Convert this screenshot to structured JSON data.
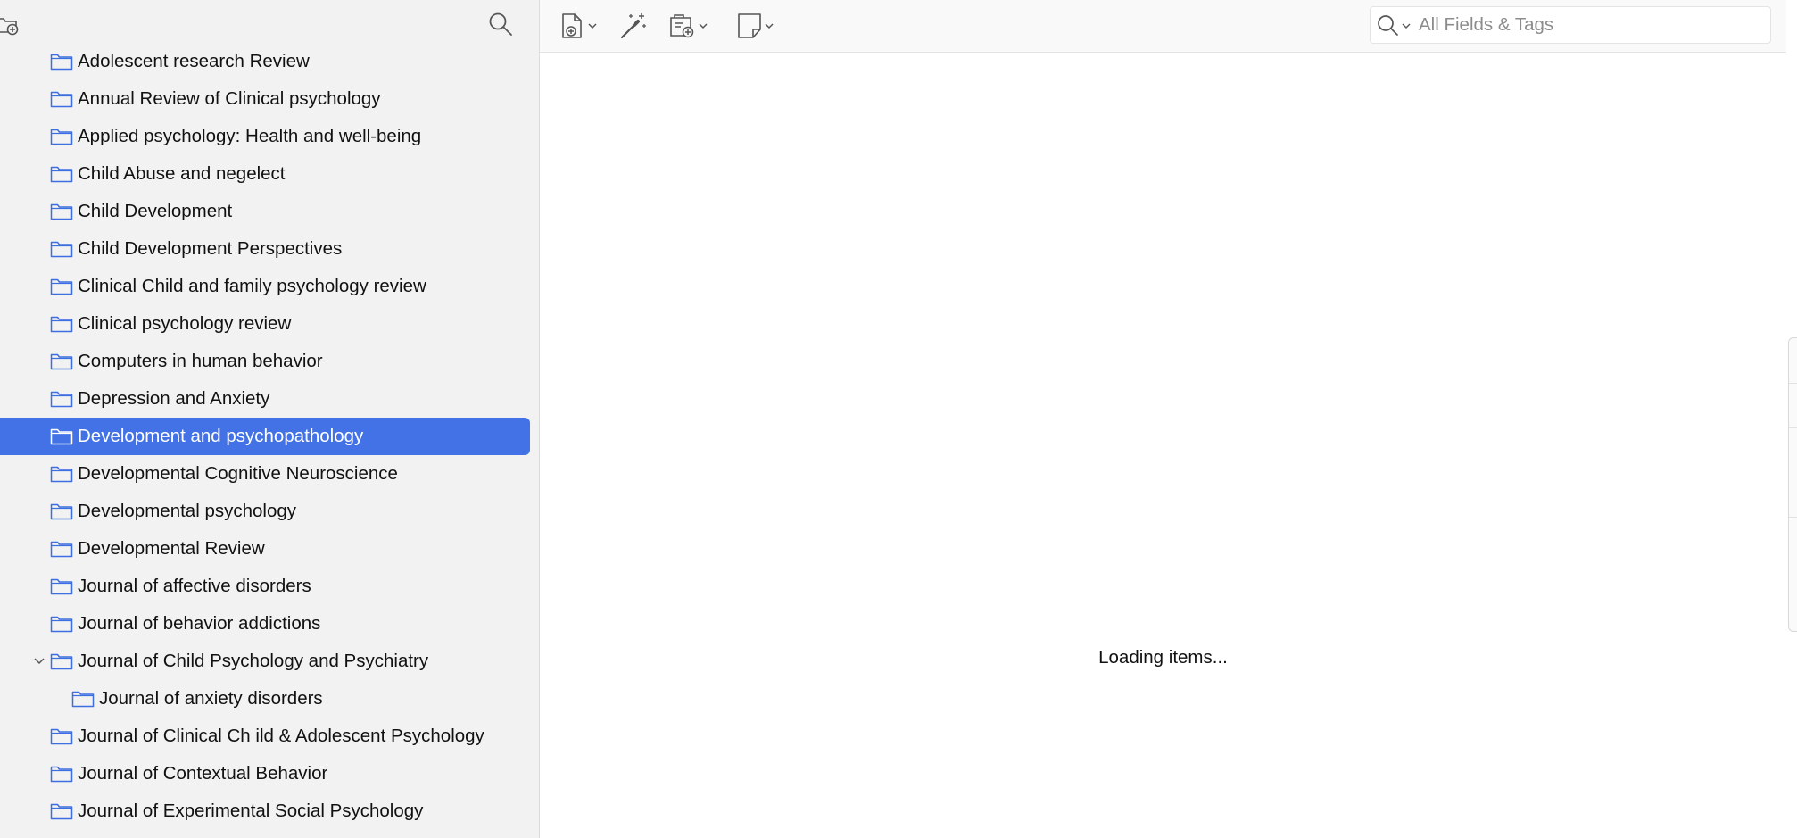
{
  "sidebar": {
    "collections": [
      {
        "label": "Adolescent research Review",
        "level": 0,
        "selected": false,
        "expandable": false
      },
      {
        "label": "Annual Review of Clinical psychology",
        "level": 0,
        "selected": false,
        "expandable": false
      },
      {
        "label": "Applied psychology: Health and well-being",
        "level": 0,
        "selected": false,
        "expandable": false
      },
      {
        "label": "Child Abuse and negelect",
        "level": 0,
        "selected": false,
        "expandable": false
      },
      {
        "label": "Child Development",
        "level": 0,
        "selected": false,
        "expandable": false
      },
      {
        "label": "Child Development Perspectives",
        "level": 0,
        "selected": false,
        "expandable": false
      },
      {
        "label": "Clinical Child and family psychology review",
        "level": 0,
        "selected": false,
        "expandable": false
      },
      {
        "label": "Clinical psychology review",
        "level": 0,
        "selected": false,
        "expandable": false
      },
      {
        "label": "Computers in human behavior",
        "level": 0,
        "selected": false,
        "expandable": false
      },
      {
        "label": "Depression and Anxiety",
        "level": 0,
        "selected": false,
        "expandable": false
      },
      {
        "label": "Development and psychopathology",
        "level": 0,
        "selected": true,
        "expandable": false
      },
      {
        "label": "Developmental Cognitive Neuroscience",
        "level": 0,
        "selected": false,
        "expandable": false
      },
      {
        "label": "Developmental psychology",
        "level": 0,
        "selected": false,
        "expandable": false
      },
      {
        "label": "Developmental Review",
        "level": 0,
        "selected": false,
        "expandable": false
      },
      {
        "label": "Journal of affective disorders",
        "level": 0,
        "selected": false,
        "expandable": false
      },
      {
        "label": "Journal of behavior addictions",
        "level": 0,
        "selected": false,
        "expandable": false
      },
      {
        "label": "Journal of Child Psychology and Psychiatry",
        "level": 0,
        "selected": false,
        "expandable": true,
        "expanded": true
      },
      {
        "label": "Journal of anxiety disorders",
        "level": 1,
        "selected": false,
        "expandable": false
      },
      {
        "label": "Journal of Clinical Ch ild & Adolescent Psychology",
        "level": 0,
        "selected": false,
        "expandable": false
      },
      {
        "label": "Journal of Contextual Behavior",
        "level": 0,
        "selected": false,
        "expandable": false
      },
      {
        "label": "Journal of Experimental Social Psychology",
        "level": 0,
        "selected": false,
        "expandable": false
      }
    ]
  },
  "main": {
    "search": {
      "placeholder": "All Fields & Tags",
      "value": ""
    },
    "status_text": "Loading items..."
  },
  "colors": {
    "selection": "#4372e6",
    "folder_icon": "#3d6fe0",
    "sidebar_bg": "#f2f2f2",
    "toolbar_icon": "#555555"
  }
}
